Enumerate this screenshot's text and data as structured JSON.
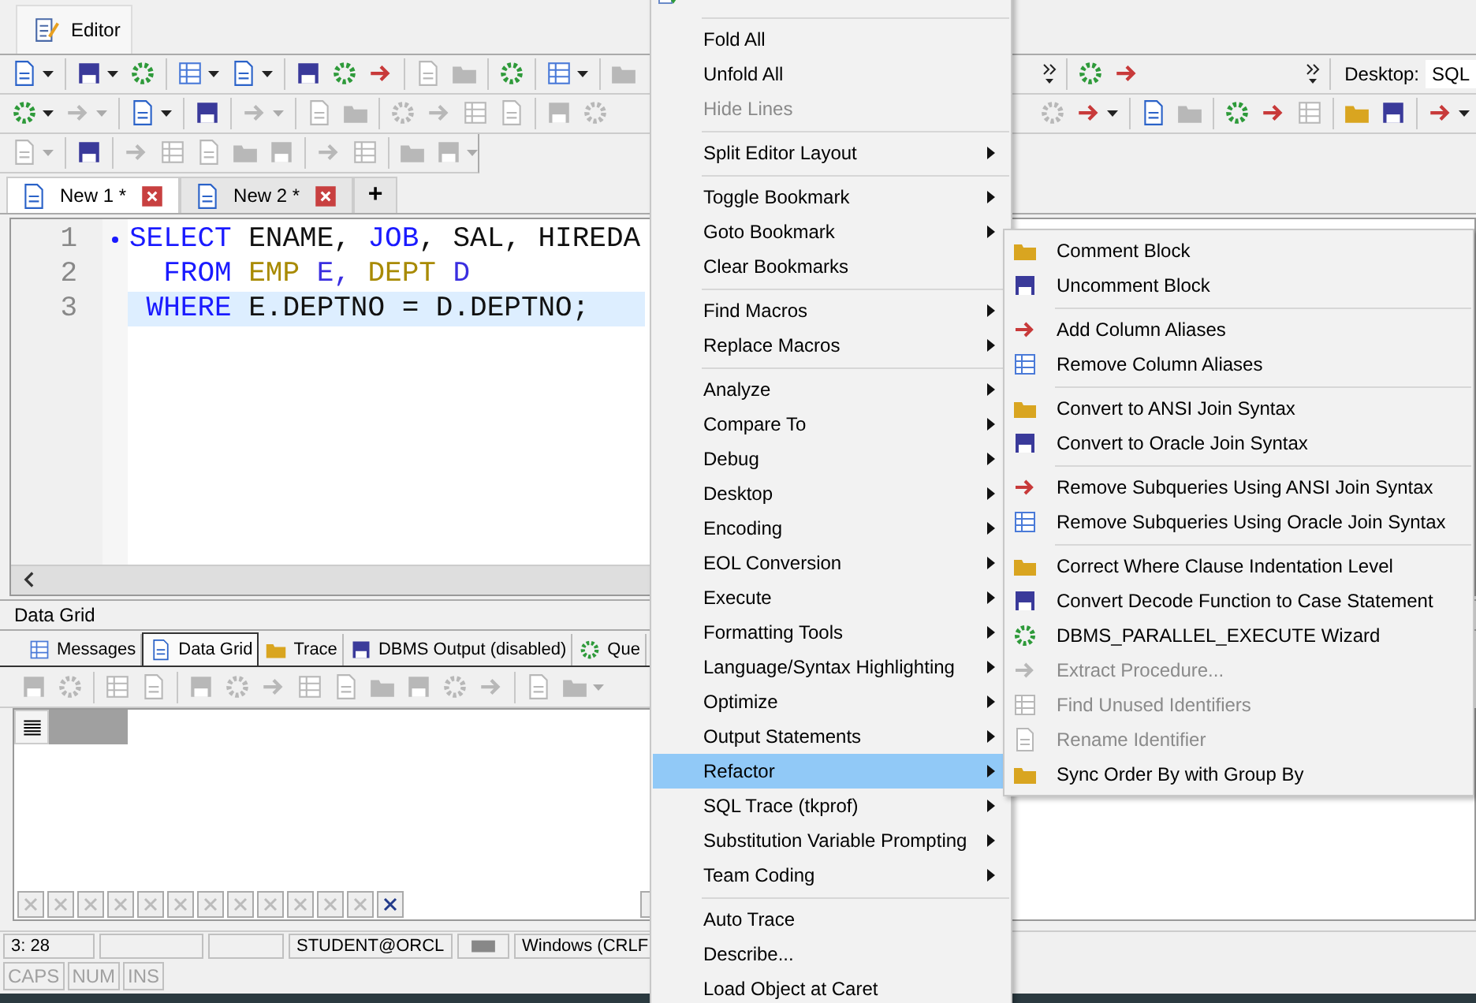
{
  "doc_tabs": [
    {
      "label": "Editor",
      "selected": true
    }
  ],
  "toolbars": [
    {
      "left": [
        {
          "kind": "button",
          "disabled": false,
          "dropdown": true
        },
        {
          "kind": "separator"
        },
        {
          "kind": "button",
          "disabled": false,
          "dropdown": true
        },
        {
          "kind": "button",
          "disabled": false,
          "dropdown": false
        },
        {
          "kind": "separator"
        },
        {
          "kind": "button",
          "disabled": false,
          "dropdown": true
        },
        {
          "kind": "button",
          "disabled": false,
          "dropdown": true
        },
        {
          "kind": "separator"
        },
        {
          "kind": "button",
          "disabled": false,
          "dropdown": false
        },
        {
          "kind": "button",
          "disabled": false,
          "dropdown": false
        },
        {
          "kind": "button",
          "disabled": false,
          "dropdown": false
        },
        {
          "kind": "separator"
        },
        {
          "kind": "button",
          "disabled": true,
          "dropdown": false
        },
        {
          "kind": "button",
          "disabled": true,
          "dropdown": false
        },
        {
          "kind": "separator"
        },
        {
          "kind": "button",
          "disabled": false,
          "dropdown": false
        },
        {
          "kind": "separator"
        },
        {
          "kind": "button",
          "disabled": false,
          "dropdown": true
        },
        {
          "kind": "separator"
        },
        {
          "kind": "button",
          "disabled": true,
          "dropdown": false
        }
      ],
      "right": [
        {
          "kind": "overflow"
        },
        {
          "kind": "separator"
        },
        {
          "kind": "button",
          "disabled": false,
          "dropdown": false
        },
        {
          "kind": "button",
          "disabled": false,
          "dropdown": false
        },
        {
          "kind": "spacer"
        },
        {
          "kind": "overflow"
        },
        {
          "kind": "separator"
        }
      ]
    },
    {
      "left": [
        {
          "kind": "button",
          "disabled": false,
          "dropdown": true
        },
        {
          "kind": "button",
          "disabled": true,
          "dropdown": true
        },
        {
          "kind": "separator"
        },
        {
          "kind": "button",
          "disabled": false,
          "dropdown": true
        },
        {
          "kind": "separator"
        },
        {
          "kind": "button",
          "disabled": false,
          "dropdown": false
        },
        {
          "kind": "separator"
        },
        {
          "kind": "button",
          "disabled": true,
          "dropdown": true
        },
        {
          "kind": "separator"
        },
        {
          "kind": "button",
          "disabled": true,
          "dropdown": false
        },
        {
          "kind": "button",
          "disabled": true,
          "dropdown": false
        },
        {
          "kind": "separator"
        },
        {
          "kind": "button",
          "disabled": true,
          "dropdown": false
        },
        {
          "kind": "button",
          "disabled": true,
          "dropdown": false
        },
        {
          "kind": "button",
          "disabled": true,
          "dropdown": false
        },
        {
          "kind": "button",
          "disabled": true,
          "dropdown": false
        },
        {
          "kind": "separator"
        },
        {
          "kind": "button",
          "disabled": true,
          "dropdown": false
        },
        {
          "kind": "button",
          "disabled": true,
          "dropdown": false
        }
      ],
      "right": [
        {
          "kind": "button",
          "disabled": true,
          "dropdown": false
        },
        {
          "kind": "button",
          "disabled": false,
          "dropdown": true
        },
        {
          "kind": "separator"
        },
        {
          "kind": "button",
          "disabled": false,
          "dropdown": false
        },
        {
          "kind": "button",
          "disabled": true,
          "dropdown": false
        },
        {
          "kind": "separator"
        },
        {
          "kind": "button",
          "disabled": false,
          "dropdown": false
        },
        {
          "kind": "button",
          "disabled": false,
          "dropdown": false
        },
        {
          "kind": "button",
          "disabled": true,
          "dropdown": false
        },
        {
          "kind": "separator"
        },
        {
          "kind": "button",
          "disabled": false,
          "dropdown": false
        },
        {
          "kind": "button",
          "disabled": false,
          "dropdown": false
        },
        {
          "kind": "separator"
        },
        {
          "kind": "button",
          "disabled": false,
          "dropdown": true
        }
      ]
    },
    {
      "left": [
        {
          "kind": "button",
          "disabled": true,
          "dropdown": true
        },
        {
          "kind": "separator"
        },
        {
          "kind": "button",
          "disabled": false,
          "dropdown": false
        },
        {
          "kind": "separator"
        },
        {
          "kind": "button",
          "disabled": true,
          "dropdown": false
        },
        {
          "kind": "button",
          "disabled": true,
          "dropdown": false
        },
        {
          "kind": "button",
          "disabled": true,
          "dropdown": false
        },
        {
          "kind": "button",
          "disabled": true,
          "dropdown": false
        },
        {
          "kind": "button",
          "disabled": true,
          "dropdown": false
        },
        {
          "kind": "separator"
        },
        {
          "kind": "button",
          "disabled": true,
          "dropdown": false
        },
        {
          "kind": "button",
          "disabled": true,
          "dropdown": false
        },
        {
          "kind": "separator"
        },
        {
          "kind": "button",
          "disabled": true,
          "dropdown": false
        },
        {
          "kind": "button",
          "disabled": true,
          "dropdown": true
        }
      ]
    }
  ],
  "desktop": {
    "label": "Desktop:",
    "value": "SQL"
  },
  "editor_tabs": [
    {
      "label": "New 1 *",
      "selected": true
    },
    {
      "label": "New 2 *",
      "selected": false
    }
  ],
  "add_tab": "+",
  "editor": {
    "lines": [
      {
        "number": "1",
        "marker": true,
        "current": false,
        "tokens": [
          {
            "kind": "keyword",
            "text": "SELECT"
          },
          {
            "kind": "plain",
            "text": " ENAME, "
          },
          {
            "kind": "keyword",
            "text": "JOB"
          },
          {
            "kind": "plain",
            "text": ", SAL, HIREDA"
          }
        ]
      },
      {
        "number": "2",
        "marker": false,
        "current": false,
        "tokens": [
          {
            "kind": "keyword",
            "text": "  FROM "
          },
          {
            "kind": "object",
            "text": "EMP"
          },
          {
            "kind": "alias",
            "text": " E, "
          },
          {
            "kind": "object",
            "text": "DEPT"
          },
          {
            "kind": "alias",
            "text": " D"
          }
        ]
      },
      {
        "number": "3",
        "marker": false,
        "current": true,
        "tokens": [
          {
            "kind": "keyword",
            "text": " WHERE"
          },
          {
            "kind": "plain",
            "text": " E.DEPTNO = D.DEPTNO;"
          }
        ]
      }
    ]
  },
  "results": {
    "title": "Data Grid",
    "tabs": [
      {
        "label": "Messages",
        "selected": false
      },
      {
        "label": "Data Grid",
        "selected": true
      },
      {
        "label": "Trace",
        "selected": false
      },
      {
        "label": "DBMS Output (disabled)",
        "selected": false
      },
      {
        "label": "Que",
        "selected": false
      }
    ],
    "toolbar": [
      {
        "kind": "button",
        "disabled": true,
        "dropdown": false
      },
      {
        "kind": "button",
        "disabled": true,
        "dropdown": false
      },
      {
        "kind": "separator"
      },
      {
        "kind": "button",
        "disabled": true,
        "dropdown": false
      },
      {
        "kind": "button",
        "disabled": true,
        "dropdown": false
      },
      {
        "kind": "separator"
      },
      {
        "kind": "button",
        "disabled": true,
        "dropdown": false
      },
      {
        "kind": "button",
        "disabled": true,
        "dropdown": false
      },
      {
        "kind": "button",
        "disabled": true,
        "dropdown": false
      },
      {
        "kind": "button",
        "disabled": true,
        "dropdown": false
      },
      {
        "kind": "button",
        "disabled": true,
        "dropdown": false
      },
      {
        "kind": "button",
        "disabled": true,
        "dropdown": false
      },
      {
        "kind": "button",
        "disabled": true,
        "dropdown": false
      },
      {
        "kind": "button",
        "disabled": true,
        "dropdown": false
      },
      {
        "kind": "button",
        "disabled": true,
        "dropdown": false
      },
      {
        "kind": "separator"
      },
      {
        "kind": "button",
        "disabled": true,
        "dropdown": false
      },
      {
        "kind": "button",
        "disabled": true,
        "dropdown": true
      }
    ],
    "navigator": [
      {
        "disabled": true
      },
      {
        "disabled": true
      },
      {
        "disabled": true
      },
      {
        "disabled": true
      },
      {
        "disabled": true
      },
      {
        "disabled": true
      },
      {
        "disabled": true
      },
      {
        "disabled": true
      },
      {
        "disabled": true
      },
      {
        "disabled": true
      },
      {
        "disabled": true
      },
      {
        "disabled": true
      },
      {
        "disabled": false
      }
    ]
  },
  "status_bar": {
    "position": "3:  28",
    "connection": "STUDENT@ORCL",
    "line_ending": "Windows (CRLF",
    "indicators": [
      {
        "label": "CAPS",
        "on": false
      },
      {
        "label": "NUM",
        "on": false
      },
      {
        "label": "INS",
        "on": false
      }
    ]
  },
  "context_menu": {
    "items": [
      {
        "kind": "item",
        "icon": true,
        "disabled": false,
        "submenu": false,
        "selected": false
      },
      {
        "kind": "separator"
      },
      {
        "kind": "item",
        "label": "Fold All",
        "disabled": false,
        "submenu": false,
        "selected": false
      },
      {
        "kind": "item",
        "label": "Unfold All",
        "disabled": false,
        "submenu": false,
        "selected": false
      },
      {
        "kind": "item",
        "label": "Hide Lines",
        "disabled": true,
        "submenu": false,
        "selected": false
      },
      {
        "kind": "separator"
      },
      {
        "kind": "item",
        "label": "Split Editor Layout",
        "disabled": false,
        "submenu": true,
        "selected": false
      },
      {
        "kind": "separator"
      },
      {
        "kind": "item",
        "label": "Toggle Bookmark",
        "disabled": false,
        "submenu": true,
        "selected": false
      },
      {
        "kind": "item",
        "label": "Goto Bookmark",
        "disabled": false,
        "submenu": true,
        "selected": false
      },
      {
        "kind": "item",
        "label": "Clear Bookmarks",
        "disabled": false,
        "submenu": false,
        "selected": false
      },
      {
        "kind": "separator"
      },
      {
        "kind": "item",
        "label": "Find Macros",
        "disabled": false,
        "submenu": true,
        "selected": false
      },
      {
        "kind": "item",
        "label": "Replace Macros",
        "disabled": false,
        "submenu": true,
        "selected": false
      },
      {
        "kind": "separator"
      },
      {
        "kind": "item",
        "label": "Analyze",
        "disabled": false,
        "submenu": true,
        "selected": false
      },
      {
        "kind": "item",
        "label": "Compare To",
        "disabled": false,
        "submenu": true,
        "selected": false
      },
      {
        "kind": "item",
        "label": "Debug",
        "disabled": false,
        "submenu": true,
        "selected": false
      },
      {
        "kind": "item",
        "label": "Desktop",
        "disabled": false,
        "submenu": true,
        "selected": false
      },
      {
        "kind": "item",
        "label": "Encoding",
        "disabled": false,
        "submenu": true,
        "selected": false
      },
      {
        "kind": "item",
        "label": "EOL Conversion",
        "disabled": false,
        "submenu": true,
        "selected": false
      },
      {
        "kind": "item",
        "label": "Execute",
        "disabled": false,
        "submenu": true,
        "selected": false
      },
      {
        "kind": "item",
        "label": "Formatting Tools",
        "disabled": false,
        "submenu": true,
        "selected": false
      },
      {
        "kind": "item",
        "label": "Language/Syntax Highlighting",
        "disabled": false,
        "submenu": true,
        "selected": false
      },
      {
        "kind": "item",
        "label": "Optimize",
        "disabled": false,
        "submenu": true,
        "selected": false
      },
      {
        "kind": "item",
        "label": "Output Statements",
        "disabled": false,
        "submenu": true,
        "selected": false
      },
      {
        "kind": "item",
        "label": "Refactor",
        "disabled": false,
        "submenu": true,
        "selected": true
      },
      {
        "kind": "item",
        "label": "SQL Trace (tkprof)",
        "disabled": false,
        "submenu": true,
        "selected": false
      },
      {
        "kind": "item",
        "label": "Substitution Variable Prompting",
        "disabled": false,
        "submenu": true,
        "selected": false
      },
      {
        "kind": "item",
        "label": "Team Coding",
        "disabled": false,
        "submenu": true,
        "selected": false
      },
      {
        "kind": "separator"
      },
      {
        "kind": "item",
        "label": "Auto Trace",
        "disabled": false,
        "submenu": false,
        "selected": false
      },
      {
        "kind": "item",
        "label": "Describe...",
        "disabled": false,
        "submenu": false,
        "selected": false
      },
      {
        "kind": "item",
        "label": "Load Object at Caret",
        "disabled": false,
        "submenu": false,
        "selected": false
      }
    ]
  },
  "refactor_submenu": {
    "items": [
      {
        "kind": "item",
        "label": "Comment Block",
        "disabled": false
      },
      {
        "kind": "item",
        "label": "Uncomment Block",
        "disabled": false
      },
      {
        "kind": "separator"
      },
      {
        "kind": "item",
        "label": "Add Column Aliases",
        "disabled": false
      },
      {
        "kind": "item",
        "label": "Remove Column Aliases",
        "disabled": false
      },
      {
        "kind": "separator"
      },
      {
        "kind": "item",
        "label": "Convert to ANSI Join Syntax",
        "disabled": false
      },
      {
        "kind": "item",
        "label": "Convert to Oracle Join Syntax",
        "disabled": false
      },
      {
        "kind": "separator"
      },
      {
        "kind": "item",
        "label": "Remove Subqueries Using ANSI Join Syntax",
        "disabled": false
      },
      {
        "kind": "item",
        "label": "Remove Subqueries Using Oracle Join Syntax",
        "disabled": false
      },
      {
        "kind": "separator"
      },
      {
        "kind": "item",
        "label": "Correct Where Clause Indentation Level",
        "disabled": false
      },
      {
        "kind": "item",
        "label": "Convert Decode Function to Case Statement",
        "disabled": false
      },
      {
        "kind": "item",
        "label": "DBMS_PARALLEL_EXECUTE Wizard",
        "disabled": false
      },
      {
        "kind": "item",
        "label": "Extract Procedure...",
        "disabled": true
      },
      {
        "kind": "item",
        "label": "Find Unused Identifiers",
        "disabled": true
      },
      {
        "kind": "item",
        "label": "Rename Identifier",
        "disabled": true
      },
      {
        "kind": "item",
        "label": "Sync Order By with Group By",
        "disabled": false
      }
    ]
  }
}
